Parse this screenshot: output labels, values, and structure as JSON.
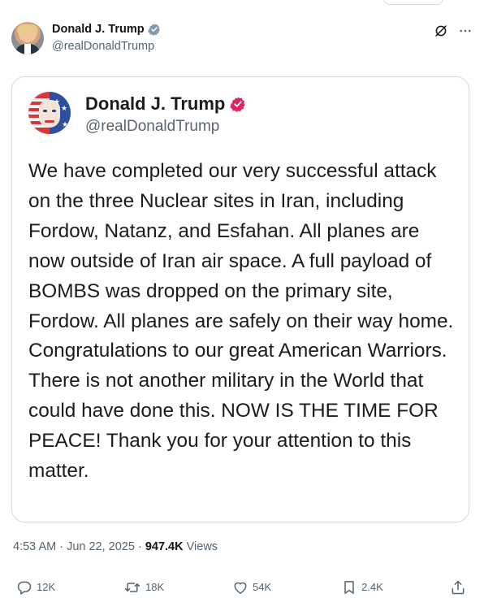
{
  "post": {
    "author_name": "Donald J. Trump",
    "author_handle": "@realDonaldTrump",
    "timestamp": "4:53 AM · Jun 22, 2025 · ",
    "views_count": "947.4K",
    "views_label": " Views"
  },
  "embedded": {
    "author_name": "Donald J. Trump",
    "author_handle": "@realDonaldTrump",
    "text": "We have completed our very successful attack on the three Nuclear sites in Iran, including Fordow, Natanz, and Esfahan. All planes are now outside of Iran air space. A full payload of BOMBS was dropped on the primary site, Fordow. All planes are safely on their way home. Congratulations to our great American Warriors. There is not another military in the World that could have done this. NOW IS THE TIME FOR PEACE! Thank you for your attention to this matter."
  },
  "actions": {
    "replies": "12K",
    "reposts": "18K",
    "likes": "54K",
    "bookmarks": "2.4K"
  },
  "colors": {
    "verified_gray": "#829aab",
    "verified_red": "#e0245e",
    "secondary_text": "#536471",
    "border": "#cfd9de"
  },
  "icons": [
    "verified-badge-icon",
    "grok-icon",
    "more-icon",
    "reply-icon",
    "repost-icon",
    "like-icon",
    "bookmark-icon",
    "share-icon"
  ]
}
